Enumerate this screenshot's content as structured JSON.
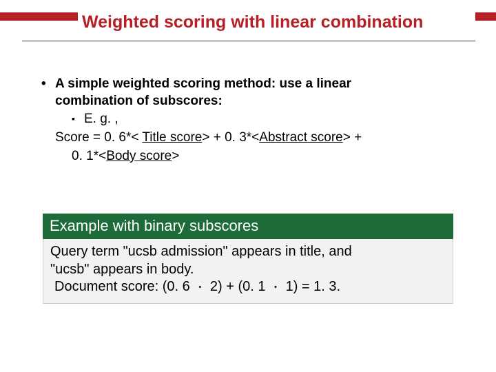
{
  "title": "Weighted  scoring with linear combination",
  "bullet": {
    "marker": "•",
    "line1": "A simple weighted scoring method: use a linear",
    "line2": "combination of subscores:"
  },
  "sub": {
    "marker": "▪",
    "label": "E. g. ,"
  },
  "formula": {
    "pre": "Score = 0. 6*< ",
    "title_score": "Title score",
    "mid1": "> + 0. 3*<",
    "abstract_score": "Abstract score",
    "mid2": "> +",
    "line2_pre": "0. 1*<",
    "body_score": "Body score",
    "line2_post": ">"
  },
  "example": {
    "header": "Example with binary subscores",
    "l1": "Query term \"ucsb admission\" appears in title, and",
    "l2": "\"ucsb\" appears in body.",
    "l3_pre": "Document score: (0. 6 ",
    "l3_mid1": " 2) + (0. 1 ",
    "l3_post": " 1) = 1. 3.",
    "dot": "・"
  }
}
